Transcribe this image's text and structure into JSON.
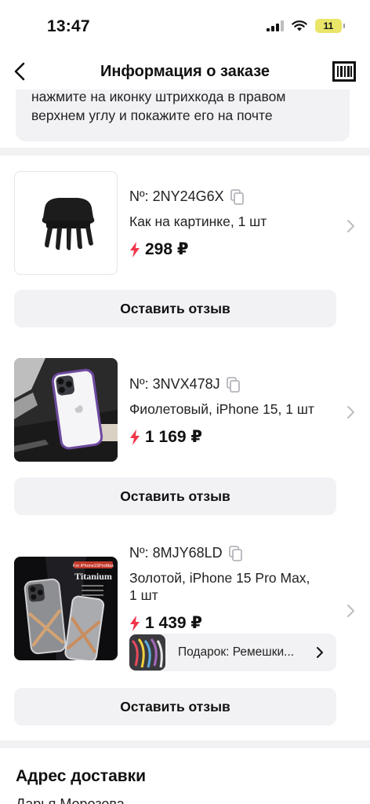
{
  "status_bar": {
    "time": "13:47",
    "battery": "11"
  },
  "header": {
    "title": "Информация о заказе"
  },
  "notice": {
    "line1": "нажмите на иконку штрихкода в правом",
    "line2": "верхнем углу и покажите его на почте"
  },
  "products": [
    {
      "number": "Nº: 2NY24G6X",
      "description": "Как на картинке, 1 шт",
      "price": "298 ₽",
      "review_label": "Оставить отзыв"
    },
    {
      "number": "Nº: 3NVX478J",
      "description": "Фиолетовый, iPhone 15, 1 шт",
      "price": "1 169 ₽",
      "review_label": "Оставить отзыв"
    },
    {
      "number": "Nº: 8MJY68LD",
      "description_line1": "Золотой, iPhone 15 Pro Max,",
      "description_line2": "1 шт",
      "price": "1 439 ₽",
      "gift_label": "Подарок: Ремешки...",
      "image_badge": "For iPhone15ProMax",
      "image_title": "Titanium",
      "review_label": "Оставить отзыв"
    }
  ],
  "delivery": {
    "title": "Адрес доставки",
    "recipient": "Дарья Морозова"
  },
  "colors": {
    "accent": "#f0354a",
    "button_bg": "#f2f2f5",
    "separator": "#f2f2f5"
  }
}
